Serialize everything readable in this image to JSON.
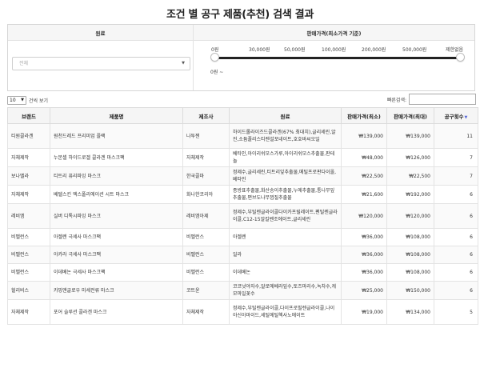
{
  "page_title": "조건 별 공구 제품(추천) 검색 결과",
  "filters": {
    "ingredient_header": "원료",
    "price_header": "판매가격(최소가격 기준)",
    "ingredient_placeholder": "전체",
    "price_ticks": [
      "0원",
      "30,000원",
      "50,000원",
      "100,000원",
      "200,000원",
      "500,000원",
      "제한없음"
    ],
    "price_range_text": "0원 ~"
  },
  "table_controls": {
    "page_length_value": "10",
    "page_length_suffix": "건씩 보기",
    "search_label": "빠른검색:"
  },
  "table": {
    "columns": [
      "브랜드",
      "제품명",
      "제조사",
      "원료",
      "판매가격(최소)",
      "판매가격(최대)",
      "공구횟수"
    ],
    "rows": [
      {
        "brand": "티원콜라겐",
        "product": "원천드레드 프리미엄 플랙",
        "maker": "나투젠",
        "ingredient": "하이드롤라이즈드콜라겐(67% 최대치),글리세린,알진,소듐폴리스티렌설포네이트,호호바씨오일",
        "min_price": "₩139,000",
        "max_price": "₩139,000",
        "count": "11"
      },
      {
        "brand": "자체제작",
        "product": "누본셀 하이드로겔 콜라겐 마스크팩",
        "maker": "자체제작",
        "ingredient": "베타인,아이리쉬모스가루,아이리쉬모스추출물,판테놀",
        "min_price": "₩48,000",
        "max_price": "₩126,000",
        "count": "7"
      },
      {
        "brand": "보나벨라",
        "product": "티트리 퓨리파잉 마스크",
        "maker": "한국콜마",
        "ingredient": "정제수,글리세린,티트리잎추출물,메틸프로판다이올,베타인",
        "min_price": "₩22,500",
        "max_price": "₩22,500",
        "count": "7"
      },
      {
        "brand": "자체제작",
        "product": "베텔스킨 엑스폴리에이션 시트 마스크",
        "maker": "화나한코리아",
        "ingredient": "종방표추출물,화산송이추출물,누에추출물,퉁나무잎추출물,편브도나무껍질추출물",
        "min_price": "₩21,600",
        "max_price": "₩192,000",
        "count": "6"
      },
      {
        "brand": "레비엠",
        "product": "실버 디톡시파잉 마스크",
        "maker": "레비엠아제",
        "ingredient": "정제수,부틸렌글라이콜다이카프릴레이트,펜틸렌글라이콜,C12-15알킬벤조에이트,글리세린",
        "min_price": "₩120,000",
        "max_price": "₩120,000",
        "count": "6"
      },
      {
        "brand": "비벨런스",
        "product": "아젤렌 극세사 마스크팩",
        "maker": "비벨런스",
        "ingredient": "아젤렌",
        "min_price": "₩36,000",
        "max_price": "₩108,000",
        "count": "6"
      },
      {
        "brand": "비벨런스",
        "product": "아카라 극세사 마스크팩",
        "maker": "비벨런스",
        "ingredient": "일라",
        "min_price": "₩36,000",
        "max_price": "₩108,000",
        "count": "6"
      },
      {
        "brand": "비벨런스",
        "product": "이데베논 극세사 마스크팩",
        "maker": "비벨런스",
        "ingredient": "이데베논",
        "min_price": "₩36,000",
        "max_price": "₩108,000",
        "count": "6"
      },
      {
        "brand": "헐리비스",
        "product": "카밍앤글로우 미세전류 마스크",
        "maker": "코트윤",
        "ingredient": "코코넛야자수,알로에베라잎수,토즈마리수,녹차수,캐모마일꽃수",
        "min_price": "₩25,000",
        "max_price": "₩150,000",
        "count": "6"
      },
      {
        "brand": "자체제작",
        "product": "포어 슬루션 콜라겐 마스크",
        "maker": "자체제작",
        "ingredient": "정제수,부틸렌글라이콜,다이프로필렌글라이콜,나이아신아마이드,세틸에틸헥사노에이트",
        "min_price": "₩19,000",
        "max_price": "₩134,000",
        "count": "5"
      }
    ]
  },
  "colors": {
    "accent_sort": "#5b6bd8",
    "slider_track": "#222222"
  }
}
